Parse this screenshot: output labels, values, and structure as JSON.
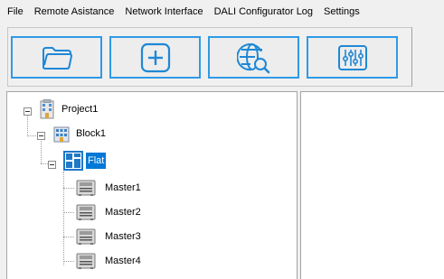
{
  "menubar": {
    "items": [
      {
        "label": "File"
      },
      {
        "label": "Remote Asistance"
      },
      {
        "label": "Network Interface"
      },
      {
        "label": "DALI Configurator Log"
      },
      {
        "label": "Settings"
      }
    ]
  },
  "toolbar": {
    "buttons": [
      {
        "icon": "folder-icon"
      },
      {
        "icon": "add-icon"
      },
      {
        "icon": "network-search-icon"
      },
      {
        "icon": "sliders-icon"
      }
    ],
    "accent_color": "#2f9ae6"
  },
  "tree": {
    "project": {
      "label": "Project1",
      "icon": "building-icon"
    },
    "block": {
      "label": "Block1",
      "icon": "building-block-icon"
    },
    "flat": {
      "label": "Flat",
      "icon": "floorplan-icon",
      "selected": true
    },
    "masters": [
      {
        "label": "Master1",
        "icon": "dali-master-device-icon"
      },
      {
        "label": "Master2",
        "icon": "dali-master-device-icon"
      },
      {
        "label": "Master3",
        "icon": "dali-master-device-icon"
      },
      {
        "label": "Master4",
        "icon": "dali-master-device-icon"
      }
    ]
  }
}
